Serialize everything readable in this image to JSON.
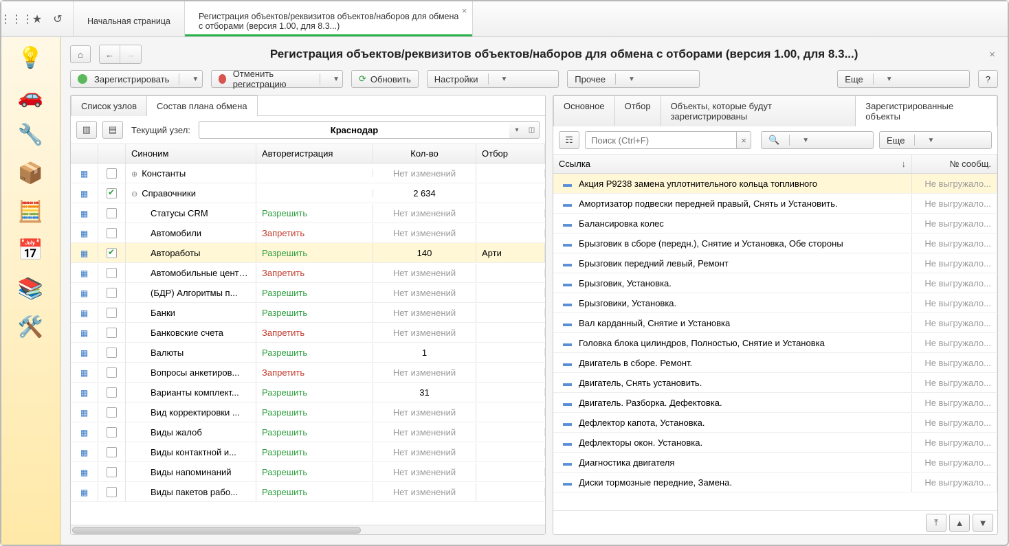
{
  "top_tabs": [
    {
      "line1": "Начальная страница",
      "line2": ""
    },
    {
      "line1": "Регистрация объектов/реквизитов объектов/наборов для обмена",
      "line2": "с отборами (версия 1.00, для 8.3...)"
    }
  ],
  "page_title": "Регистрация объектов/реквизитов объектов/наборов для обмена с отборами (версия 1.00, для 8.3...)",
  "toolbar": {
    "register": "Зарегистрировать",
    "unregister": "Отменить регистрацию",
    "refresh": "Обновить",
    "settings": "Настройки",
    "other": "Прочее",
    "more": "Еще",
    "help": "?"
  },
  "left_pane": {
    "tabs": [
      "Список узлов",
      "Состав плана обмена"
    ],
    "current_node_label": "Текущий узел:",
    "current_node_value": "Краснодар",
    "columns": {
      "syn": "Синоним",
      "auto": "Авторегистрация",
      "count": "Кол-во",
      "filter": "Отбор"
    },
    "auto_text": {
      "allow": "Разрешить",
      "deny": "Запретить"
    },
    "no_changes": "Нет изменений",
    "rows": [
      {
        "icon": "group",
        "check": false,
        "tree": "+",
        "name": "Константы",
        "auto": "",
        "count": "Нет изменений",
        "muted": true
      },
      {
        "icon": "table",
        "check": true,
        "tree": "-",
        "name": "Справочники",
        "auto": "",
        "count": "2 634",
        "muted": false
      },
      {
        "icon": "table",
        "check": false,
        "indent": true,
        "name": "Статусы CRM",
        "auto": "allow",
        "count": "Нет изменений",
        "muted": true
      },
      {
        "icon": "table",
        "check": false,
        "indent": true,
        "name": "Автомобили",
        "auto": "deny",
        "count": "Нет изменений",
        "muted": true
      },
      {
        "icon": "table",
        "check": true,
        "indent": true,
        "name": "Автоработы",
        "auto": "allow",
        "count": "140",
        "muted": false,
        "sel": true,
        "filter": "Арти"
      },
      {
        "icon": "table",
        "check": false,
        "indent": true,
        "name": "Автомобильные центры",
        "auto": "deny",
        "count": "Нет изменений",
        "muted": true
      },
      {
        "icon": "table",
        "check": false,
        "indent": true,
        "name": "(БДР) Алгоритмы п...",
        "auto": "allow",
        "count": "Нет изменений",
        "muted": true
      },
      {
        "icon": "table",
        "check": false,
        "indent": true,
        "name": "Банки",
        "auto": "allow",
        "count": "Нет изменений",
        "muted": true
      },
      {
        "icon": "table",
        "check": false,
        "indent": true,
        "name": "Банковские счета",
        "auto": "deny",
        "count": "Нет изменений",
        "muted": true
      },
      {
        "icon": "table",
        "check": false,
        "indent": true,
        "name": "Валюты",
        "auto": "allow",
        "count": "1",
        "muted": false
      },
      {
        "icon": "table",
        "check": false,
        "indent": true,
        "name": "Вопросы анкетиров...",
        "auto": "deny",
        "count": "Нет изменений",
        "muted": true
      },
      {
        "icon": "table",
        "check": false,
        "indent": true,
        "name": "Варианты комплект...",
        "auto": "allow",
        "count": "31",
        "muted": false
      },
      {
        "icon": "table",
        "check": false,
        "indent": true,
        "name": "Вид корректировки ...",
        "auto": "allow",
        "count": "Нет изменений",
        "muted": true
      },
      {
        "icon": "table",
        "check": false,
        "indent": true,
        "name": "Виды жалоб",
        "auto": "allow",
        "count": "Нет изменений",
        "muted": true
      },
      {
        "icon": "table",
        "check": false,
        "indent": true,
        "name": "Виды контактной и...",
        "auto": "allow",
        "count": "Нет изменений",
        "muted": true
      },
      {
        "icon": "table",
        "check": false,
        "indent": true,
        "name": "Виды напоминаний",
        "auto": "allow",
        "count": "Нет изменений",
        "muted": true
      },
      {
        "icon": "table",
        "check": false,
        "indent": true,
        "name": "Виды пакетов рабо...",
        "auto": "allow",
        "count": "Нет изменений",
        "muted": true
      }
    ]
  },
  "right_pane": {
    "tabs": [
      "Основное",
      "Отбор",
      "Объекты, которые будут зарегистрированы",
      "Зарегистрированные объекты"
    ],
    "search_placeholder": "Поиск (Ctrl+F)",
    "more": "Еще",
    "columns": {
      "link": "Ссылка",
      "msg": "№ сообщ."
    },
    "msg_text": "Не выгружало...",
    "rows": [
      {
        "text": "Акция Р9238  замена уплотнительного кольца топливного",
        "sel": true
      },
      {
        "text": "Амортизатор подвески передней правый, Снять и Установить."
      },
      {
        "text": "Балансировка колес"
      },
      {
        "text": "Брызговик в сборе (передн.), Снятие и Установка, Обе стороны"
      },
      {
        "text": "Брызговик передний левый, Ремонт"
      },
      {
        "text": "Брызговик, Установка."
      },
      {
        "text": "Брызговики, Установка."
      },
      {
        "text": "Вал карданный, Снятие и Установка"
      },
      {
        "text": "Головка блока цилиндров, Полностью, Снятие и Установка"
      },
      {
        "text": "Двигатель в сборе. Ремонт."
      },
      {
        "text": "Двигатель, Снять установить."
      },
      {
        "text": "Двигатель. Разборка. Дефектовка."
      },
      {
        "text": "Дефлектор капота, Установка."
      },
      {
        "text": "Дефлекторы окон. Установка."
      },
      {
        "text": "Диагностика двигателя"
      },
      {
        "text": "Диски тормозные передние, Замена."
      }
    ]
  }
}
